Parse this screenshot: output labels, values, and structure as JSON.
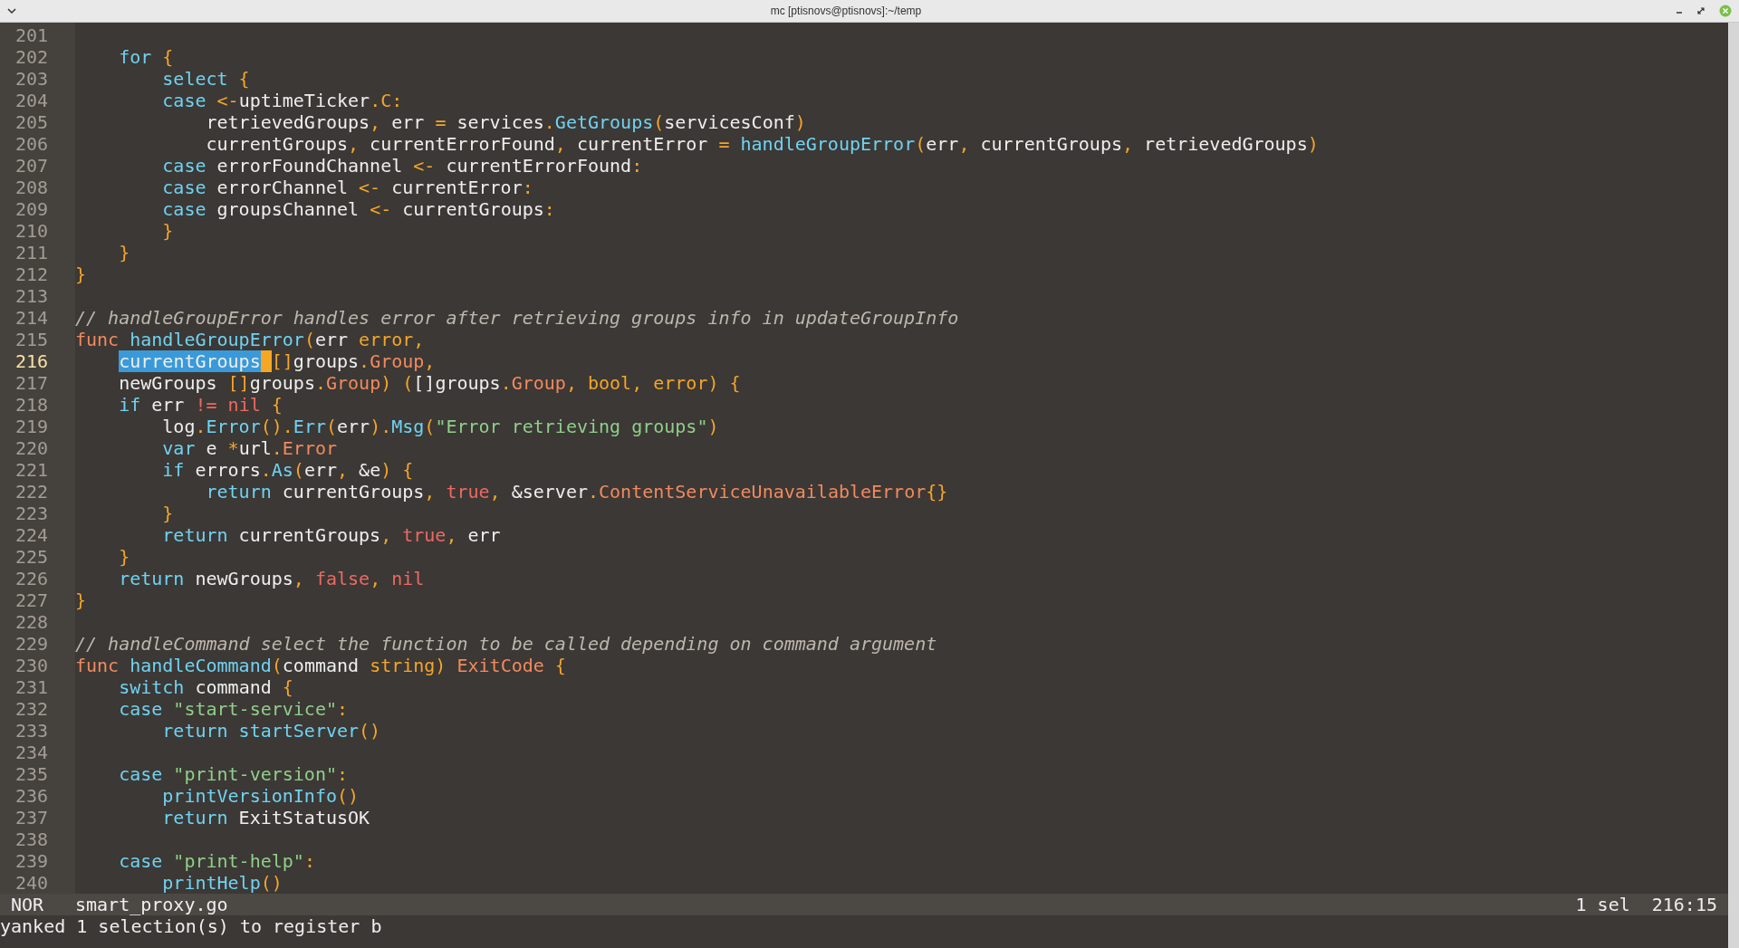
{
  "window": {
    "title": "mc [ptisnovs@ptisnovs]:~/temp"
  },
  "lines": [
    {
      "num": "201",
      "current": false
    },
    {
      "num": "202",
      "current": false,
      "tokens": [
        {
          "kind": "keyword",
          "text": "    for"
        },
        {
          "kind": "accent",
          "text": " {"
        }
      ]
    },
    {
      "num": "203",
      "current": false,
      "tokens": [
        {
          "kind": "keyword",
          "text": "        select"
        },
        {
          "kind": "accent",
          "text": " {"
        }
      ]
    },
    {
      "num": "204",
      "current": false,
      "tokens": [
        {
          "kind": "keyword",
          "text": "        case"
        },
        {
          "kind": "accent",
          "text": " <-"
        },
        {
          "kind": "plain",
          "text": "uptimeTicker"
        },
        {
          "kind": "accent",
          "text": ".C:"
        }
      ]
    },
    {
      "num": "205",
      "current": false,
      "tokens": [
        {
          "kind": "plain",
          "text": "            retrievedGroups"
        },
        {
          "kind": "accent",
          "text": ","
        },
        {
          "kind": "plain",
          "text": " err "
        },
        {
          "kind": "accent",
          "text": "="
        },
        {
          "kind": "plain",
          "text": " services"
        },
        {
          "kind": "accent",
          "text": "."
        },
        {
          "kind": "keyword",
          "text": "GetGroups"
        },
        {
          "kind": "accent",
          "text": "("
        },
        {
          "kind": "plain",
          "text": "servicesConf"
        },
        {
          "kind": "accent",
          "text": ")"
        }
      ]
    },
    {
      "num": "206",
      "current": false,
      "tokens": [
        {
          "kind": "plain",
          "text": "            currentGroups"
        },
        {
          "kind": "accent",
          "text": ","
        },
        {
          "kind": "plain",
          "text": " currentErrorFound"
        },
        {
          "kind": "accent",
          "text": ","
        },
        {
          "kind": "plain",
          "text": " currentError "
        },
        {
          "kind": "accent",
          "text": "="
        },
        {
          "kind": "keyword",
          "text": " handleGroupError"
        },
        {
          "kind": "accent",
          "text": "("
        },
        {
          "kind": "plain",
          "text": "err"
        },
        {
          "kind": "accent",
          "text": ","
        },
        {
          "kind": "plain",
          "text": " currentGroups"
        },
        {
          "kind": "accent",
          "text": ","
        },
        {
          "kind": "plain",
          "text": " retrievedGroups"
        },
        {
          "kind": "accent",
          "text": ")"
        }
      ]
    },
    {
      "num": "207",
      "current": false,
      "tokens": [
        {
          "kind": "keyword",
          "text": "        case"
        },
        {
          "kind": "plain",
          "text": " errorFoundChannel "
        },
        {
          "kind": "accent",
          "text": "<-"
        },
        {
          "kind": "plain",
          "text": " currentErrorFound"
        },
        {
          "kind": "accent",
          "text": ":"
        }
      ]
    },
    {
      "num": "208",
      "current": false,
      "tokens": [
        {
          "kind": "keyword",
          "text": "        case"
        },
        {
          "kind": "plain",
          "text": " errorChannel "
        },
        {
          "kind": "accent",
          "text": "<-"
        },
        {
          "kind": "plain",
          "text": " currentError"
        },
        {
          "kind": "accent",
          "text": ":"
        }
      ]
    },
    {
      "num": "209",
      "current": false,
      "tokens": [
        {
          "kind": "keyword",
          "text": "        case"
        },
        {
          "kind": "plain",
          "text": " groupsChannel "
        },
        {
          "kind": "accent",
          "text": "<-"
        },
        {
          "kind": "plain",
          "text": " currentGroups"
        },
        {
          "kind": "accent",
          "text": ":"
        }
      ]
    },
    {
      "num": "210",
      "current": false,
      "tokens": [
        {
          "kind": "accent",
          "text": "        }"
        }
      ]
    },
    {
      "num": "211",
      "current": false,
      "tokens": [
        {
          "kind": "accent",
          "text": "    }"
        }
      ]
    },
    {
      "num": "212",
      "current": false,
      "tokens": [
        {
          "kind": "accent",
          "text": "}"
        }
      ]
    },
    {
      "num": "213",
      "current": false
    },
    {
      "num": "214",
      "current": false,
      "tokens": [
        {
          "kind": "comment",
          "text": "// handleGroupError handles error after retrieving groups info in updateGroupInfo"
        }
      ]
    },
    {
      "num": "215",
      "current": false,
      "tokens": [
        {
          "kind": "type",
          "text": "func"
        },
        {
          "kind": "keyword",
          "text": " handleGroupError"
        },
        {
          "kind": "accent",
          "text": "("
        },
        {
          "kind": "plain",
          "text": "err "
        },
        {
          "kind": "accent",
          "text": "error,"
        }
      ]
    },
    {
      "num": "216",
      "current": true,
      "tokens": [
        {
          "kind": "selection",
          "text": "    currentGroups"
        },
        {
          "kind": "cursor"
        },
        {
          "kind": "accent",
          "text": "[]"
        },
        {
          "kind": "plain",
          "text": "groups"
        },
        {
          "kind": "accent",
          "text": "."
        },
        {
          "kind": "type",
          "text": "Group"
        },
        {
          "kind": "accent",
          "text": ","
        }
      ]
    },
    {
      "num": "217",
      "current": false,
      "tokens": [
        {
          "kind": "plain",
          "text": "    newGroups "
        },
        {
          "kind": "accent",
          "text": "[]"
        },
        {
          "kind": "plain",
          "text": "groups"
        },
        {
          "kind": "accent",
          "text": "."
        },
        {
          "kind": "type",
          "text": "Group"
        },
        {
          "kind": "accent",
          "text": ") ("
        },
        {
          "kind": "plain",
          "text": "[]groups"
        },
        {
          "kind": "accent",
          "text": "."
        },
        {
          "kind": "type",
          "text": "Group"
        },
        {
          "kind": "accent",
          "text": ", bool, error) {"
        }
      ]
    },
    {
      "num": "218",
      "current": false,
      "tokens": [
        {
          "kind": "keyword",
          "text": "    if"
        },
        {
          "kind": "plain",
          "text": " err "
        },
        {
          "kind": "literal",
          "text": "!= nil"
        },
        {
          "kind": "accent",
          "text": " {"
        }
      ]
    },
    {
      "num": "219",
      "current": false,
      "tokens": [
        {
          "kind": "plain",
          "text": "        log"
        },
        {
          "kind": "accent",
          "text": "."
        },
        {
          "kind": "keyword",
          "text": "Error"
        },
        {
          "kind": "accent",
          "text": "()."
        },
        {
          "kind": "keyword",
          "text": "Err"
        },
        {
          "kind": "accent",
          "text": "("
        },
        {
          "kind": "plain",
          "text": "err"
        },
        {
          "kind": "accent",
          "text": ")."
        },
        {
          "kind": "keyword",
          "text": "Msg"
        },
        {
          "kind": "accent",
          "text": "("
        },
        {
          "kind": "string",
          "text": "\"Error retrieving groups\""
        },
        {
          "kind": "accent",
          "text": ")"
        }
      ]
    },
    {
      "num": "220",
      "current": false,
      "tokens": [
        {
          "kind": "keyword",
          "text": "        var"
        },
        {
          "kind": "plain",
          "text": " e "
        },
        {
          "kind": "accent",
          "text": "*"
        },
        {
          "kind": "plain",
          "text": "url"
        },
        {
          "kind": "accent",
          "text": "."
        },
        {
          "kind": "type",
          "text": "Error"
        }
      ]
    },
    {
      "num": "221",
      "current": false,
      "tokens": [
        {
          "kind": "keyword",
          "text": "        if"
        },
        {
          "kind": "plain",
          "text": " errors"
        },
        {
          "kind": "accent",
          "text": "."
        },
        {
          "kind": "keyword",
          "text": "As"
        },
        {
          "kind": "accent",
          "text": "("
        },
        {
          "kind": "plain",
          "text": "err"
        },
        {
          "kind": "accent",
          "text": ","
        },
        {
          "kind": "plain",
          "text": " &e"
        },
        {
          "kind": "accent",
          "text": ") {"
        }
      ]
    },
    {
      "num": "222",
      "current": false,
      "tokens": [
        {
          "kind": "keyword",
          "text": "            return"
        },
        {
          "kind": "plain",
          "text": " currentGroups"
        },
        {
          "kind": "accent",
          "text": ","
        },
        {
          "kind": "literal",
          "text": " true"
        },
        {
          "kind": "accent",
          "text": ","
        },
        {
          "kind": "plain",
          "text": " &server"
        },
        {
          "kind": "accent",
          "text": "."
        },
        {
          "kind": "type",
          "text": "ContentServiceUnavailableError"
        },
        {
          "kind": "accent",
          "text": "{}"
        }
      ]
    },
    {
      "num": "223",
      "current": false,
      "tokens": [
        {
          "kind": "accent",
          "text": "        }"
        }
      ]
    },
    {
      "num": "224",
      "current": false,
      "tokens": [
        {
          "kind": "keyword",
          "text": "        return"
        },
        {
          "kind": "plain",
          "text": " currentGroups"
        },
        {
          "kind": "accent",
          "text": ","
        },
        {
          "kind": "literal",
          "text": " true"
        },
        {
          "kind": "accent",
          "text": ","
        },
        {
          "kind": "plain",
          "text": " err"
        }
      ]
    },
    {
      "num": "225",
      "current": false,
      "tokens": [
        {
          "kind": "accent",
          "text": "    }"
        }
      ]
    },
    {
      "num": "226",
      "current": false,
      "tokens": [
        {
          "kind": "keyword",
          "text": "    return"
        },
        {
          "kind": "plain",
          "text": " newGroups"
        },
        {
          "kind": "accent",
          "text": ","
        },
        {
          "kind": "literal",
          "text": " false"
        },
        {
          "kind": "accent",
          "text": ","
        },
        {
          "kind": "literal",
          "text": " nil"
        }
      ]
    },
    {
      "num": "227",
      "current": false,
      "tokens": [
        {
          "kind": "accent",
          "text": "}"
        }
      ]
    },
    {
      "num": "228",
      "current": false
    },
    {
      "num": "229",
      "current": false,
      "tokens": [
        {
          "kind": "comment",
          "text": "// handleCommand select the function to be called depending on command argument"
        }
      ]
    },
    {
      "num": "230",
      "current": false,
      "tokens": [
        {
          "kind": "type",
          "text": "func"
        },
        {
          "kind": "keyword",
          "text": " handleCommand"
        },
        {
          "kind": "accent",
          "text": "("
        },
        {
          "kind": "plain",
          "text": "command "
        },
        {
          "kind": "accent",
          "text": "string)"
        },
        {
          "kind": "type",
          "text": " ExitCode"
        },
        {
          "kind": "accent",
          "text": " {"
        }
      ]
    },
    {
      "num": "231",
      "current": false,
      "tokens": [
        {
          "kind": "keyword",
          "text": "    switch"
        },
        {
          "kind": "plain",
          "text": " command "
        },
        {
          "kind": "accent",
          "text": "{"
        }
      ]
    },
    {
      "num": "232",
      "current": false,
      "tokens": [
        {
          "kind": "keyword",
          "text": "    case"
        },
        {
          "kind": "string",
          "text": " \"start-service\""
        },
        {
          "kind": "accent",
          "text": ":"
        }
      ]
    },
    {
      "num": "233",
      "current": false,
      "tokens": [
        {
          "kind": "keyword",
          "text": "        return startServer"
        },
        {
          "kind": "accent",
          "text": "()"
        }
      ]
    },
    {
      "num": "234",
      "current": false
    },
    {
      "num": "235",
      "current": false,
      "tokens": [
        {
          "kind": "keyword",
          "text": "    case"
        },
        {
          "kind": "string",
          "text": " \"print-version\""
        },
        {
          "kind": "accent",
          "text": ":"
        }
      ]
    },
    {
      "num": "236",
      "current": false,
      "tokens": [
        {
          "kind": "keyword",
          "text": "        printVersionInfo"
        },
        {
          "kind": "accent",
          "text": "()"
        }
      ]
    },
    {
      "num": "237",
      "current": false,
      "tokens": [
        {
          "kind": "keyword",
          "text": "        return"
        },
        {
          "kind": "plain",
          "text": " ExitStatusOK"
        }
      ]
    },
    {
      "num": "238",
      "current": false
    },
    {
      "num": "239",
      "current": false,
      "tokens": [
        {
          "kind": "keyword",
          "text": "    case"
        },
        {
          "kind": "string",
          "text": " \"print-help\""
        },
        {
          "kind": "accent",
          "text": ":"
        }
      ]
    },
    {
      "num": "240",
      "current": false,
      "tokens": [
        {
          "kind": "keyword",
          "text": "        printHelp"
        },
        {
          "kind": "accent",
          "text": "()"
        }
      ]
    }
  ],
  "status_bar": {
    "mode": "NOR",
    "file": "smart_proxy.go",
    "selections": "1 sel",
    "position": "216:15"
  },
  "message": "yanked 1 selection(s) to register b"
}
